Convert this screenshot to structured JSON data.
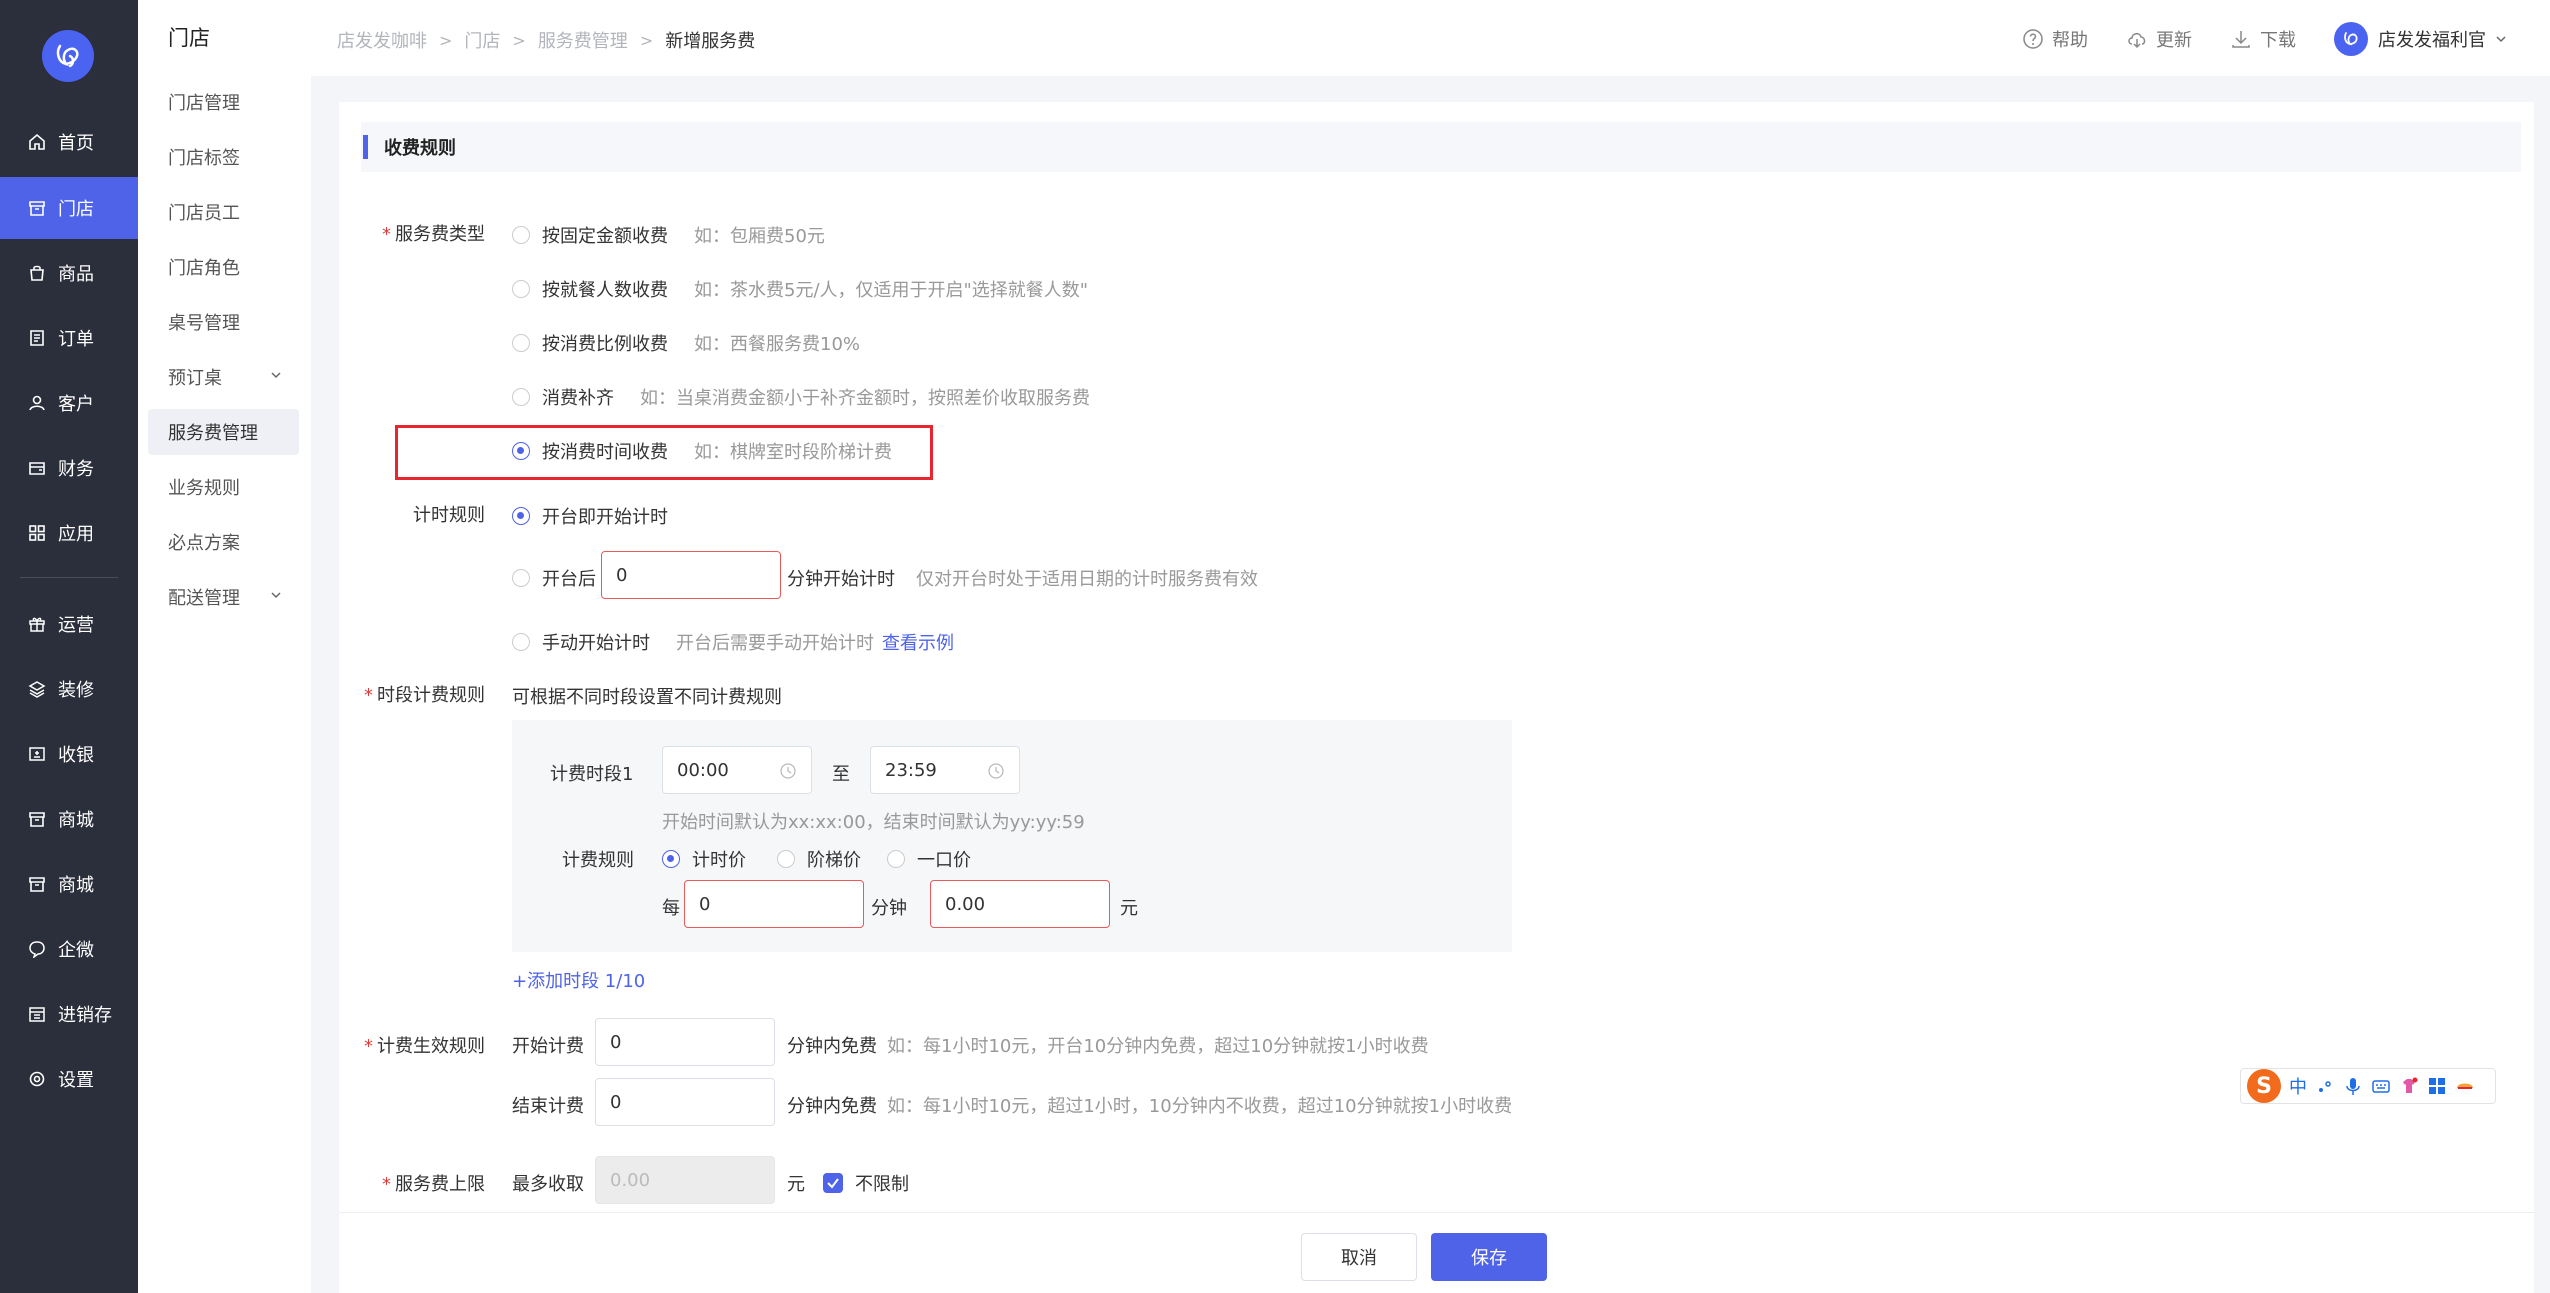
{
  "nav": {
    "items": [
      {
        "label": "首页",
        "icon": "home-icon"
      },
      {
        "label": "门店",
        "icon": "store-icon"
      },
      {
        "label": "商品",
        "icon": "bag-icon"
      },
      {
        "label": "订单",
        "icon": "order-icon"
      },
      {
        "label": "客户",
        "icon": "user-icon"
      },
      {
        "label": "财务",
        "icon": "wallet-icon"
      },
      {
        "label": "应用",
        "icon": "apps-icon"
      },
      {
        "label": "运营",
        "icon": "gift-icon"
      },
      {
        "label": "装修",
        "icon": "layers-icon"
      },
      {
        "label": "收银",
        "icon": "cashier-icon"
      },
      {
        "label": "商城",
        "icon": "shop-icon"
      },
      {
        "label": "商城",
        "icon": "shop-icon"
      },
      {
        "label": "企微",
        "icon": "chat-icon"
      },
      {
        "label": "进销存",
        "icon": "inventory-icon"
      },
      {
        "label": "设置",
        "icon": "settings-icon"
      }
    ],
    "active_index": 1,
    "active_color": "#4e63e8"
  },
  "submenu": {
    "title": "门店",
    "items": [
      {
        "label": "门店管理"
      },
      {
        "label": "门店标签"
      },
      {
        "label": "门店员工"
      },
      {
        "label": "门店角色"
      },
      {
        "label": "桌号管理"
      },
      {
        "label": "预订桌",
        "expandable": true
      },
      {
        "label": "服务费管理",
        "active": true
      },
      {
        "label": "业务规则"
      },
      {
        "label": "必点方案"
      },
      {
        "label": "配送管理",
        "expandable": true
      }
    ]
  },
  "breadcrumb": [
    "店发发咖啡",
    "门店",
    "服务费管理",
    "新增服务费"
  ],
  "header": {
    "help": "帮助",
    "update": "更新",
    "download": "下载",
    "user": "店发发福利官"
  },
  "section": {
    "title": "收费规则"
  },
  "service_type": {
    "label": "服务费类型",
    "options": [
      {
        "label": "按固定金额收费",
        "hint": "如：包厢费50元",
        "selected": false
      },
      {
        "label": "按就餐人数收费",
        "hint": "如：茶水费5元/人，仅适用于开启\"选择就餐人数\"",
        "selected": false
      },
      {
        "label": "按消费比例收费",
        "hint": "如：西餐服务费10%",
        "selected": false
      },
      {
        "label": "消费补齐",
        "hint": "如：当桌消费金额小于补齐金额时，按照差价收取服务费",
        "selected": false
      },
      {
        "label": "按消费时间收费",
        "hint": "如：棋牌室时段阶梯计费",
        "selected": true
      }
    ]
  },
  "timing_rule": {
    "label": "计时规则",
    "opt1": "开台即开始计时",
    "opt2_prefix": "开台后",
    "opt2_value": "0",
    "opt2_suffix": "分钟开始计时",
    "opt2_hint": "仅对开台时处于适用日期的计时服务费有效",
    "opt3": "手动开始计时",
    "opt3_hint": "开台后需要手动开始计时",
    "opt3_link": "查看示例"
  },
  "period_rule": {
    "label": "时段计费规则",
    "desc": "可根据不同时段设置不同计费规则",
    "period_label": "计费时段1",
    "start_time": "00:00",
    "to": "至",
    "end_time": "23:59",
    "time_hint": "开始时间默认为xx:xx:00，结束时间默认为yy:yy:59",
    "rule_label": "计费规则",
    "rule_options": [
      {
        "label": "计时价",
        "selected": true
      },
      {
        "label": "阶梯价",
        "selected": false
      },
      {
        "label": "一口价",
        "selected": false
      }
    ],
    "per": "每",
    "minutes_value": "0",
    "minutes_unit": "分钟",
    "price_value": "0.00",
    "price_unit": "元",
    "add_link": "+添加时段 1/10"
  },
  "effective_rule": {
    "label": "计费生效规则",
    "start_label": "开始计费",
    "start_value": "0",
    "start_unit": "分钟内免费",
    "start_hint": "如：每1小时10元，开台10分钟内免费，超过10分钟就按1小时收费",
    "end_label": "结束计费",
    "end_value": "0",
    "end_unit": "分钟内免费",
    "end_hint": "如：每1小时10元，超过1小时，10分钟内不收费，超过10分钟就按1小时收费"
  },
  "cap": {
    "label": "服务费上限",
    "prefix": "最多收取",
    "placeholder": "0.00",
    "unit": "元",
    "unlimited": "不限制",
    "unlimited_checked": true
  },
  "footer": {
    "cancel": "取消",
    "save": "保存"
  },
  "ime": {
    "logo": "S",
    "lang": "中"
  }
}
